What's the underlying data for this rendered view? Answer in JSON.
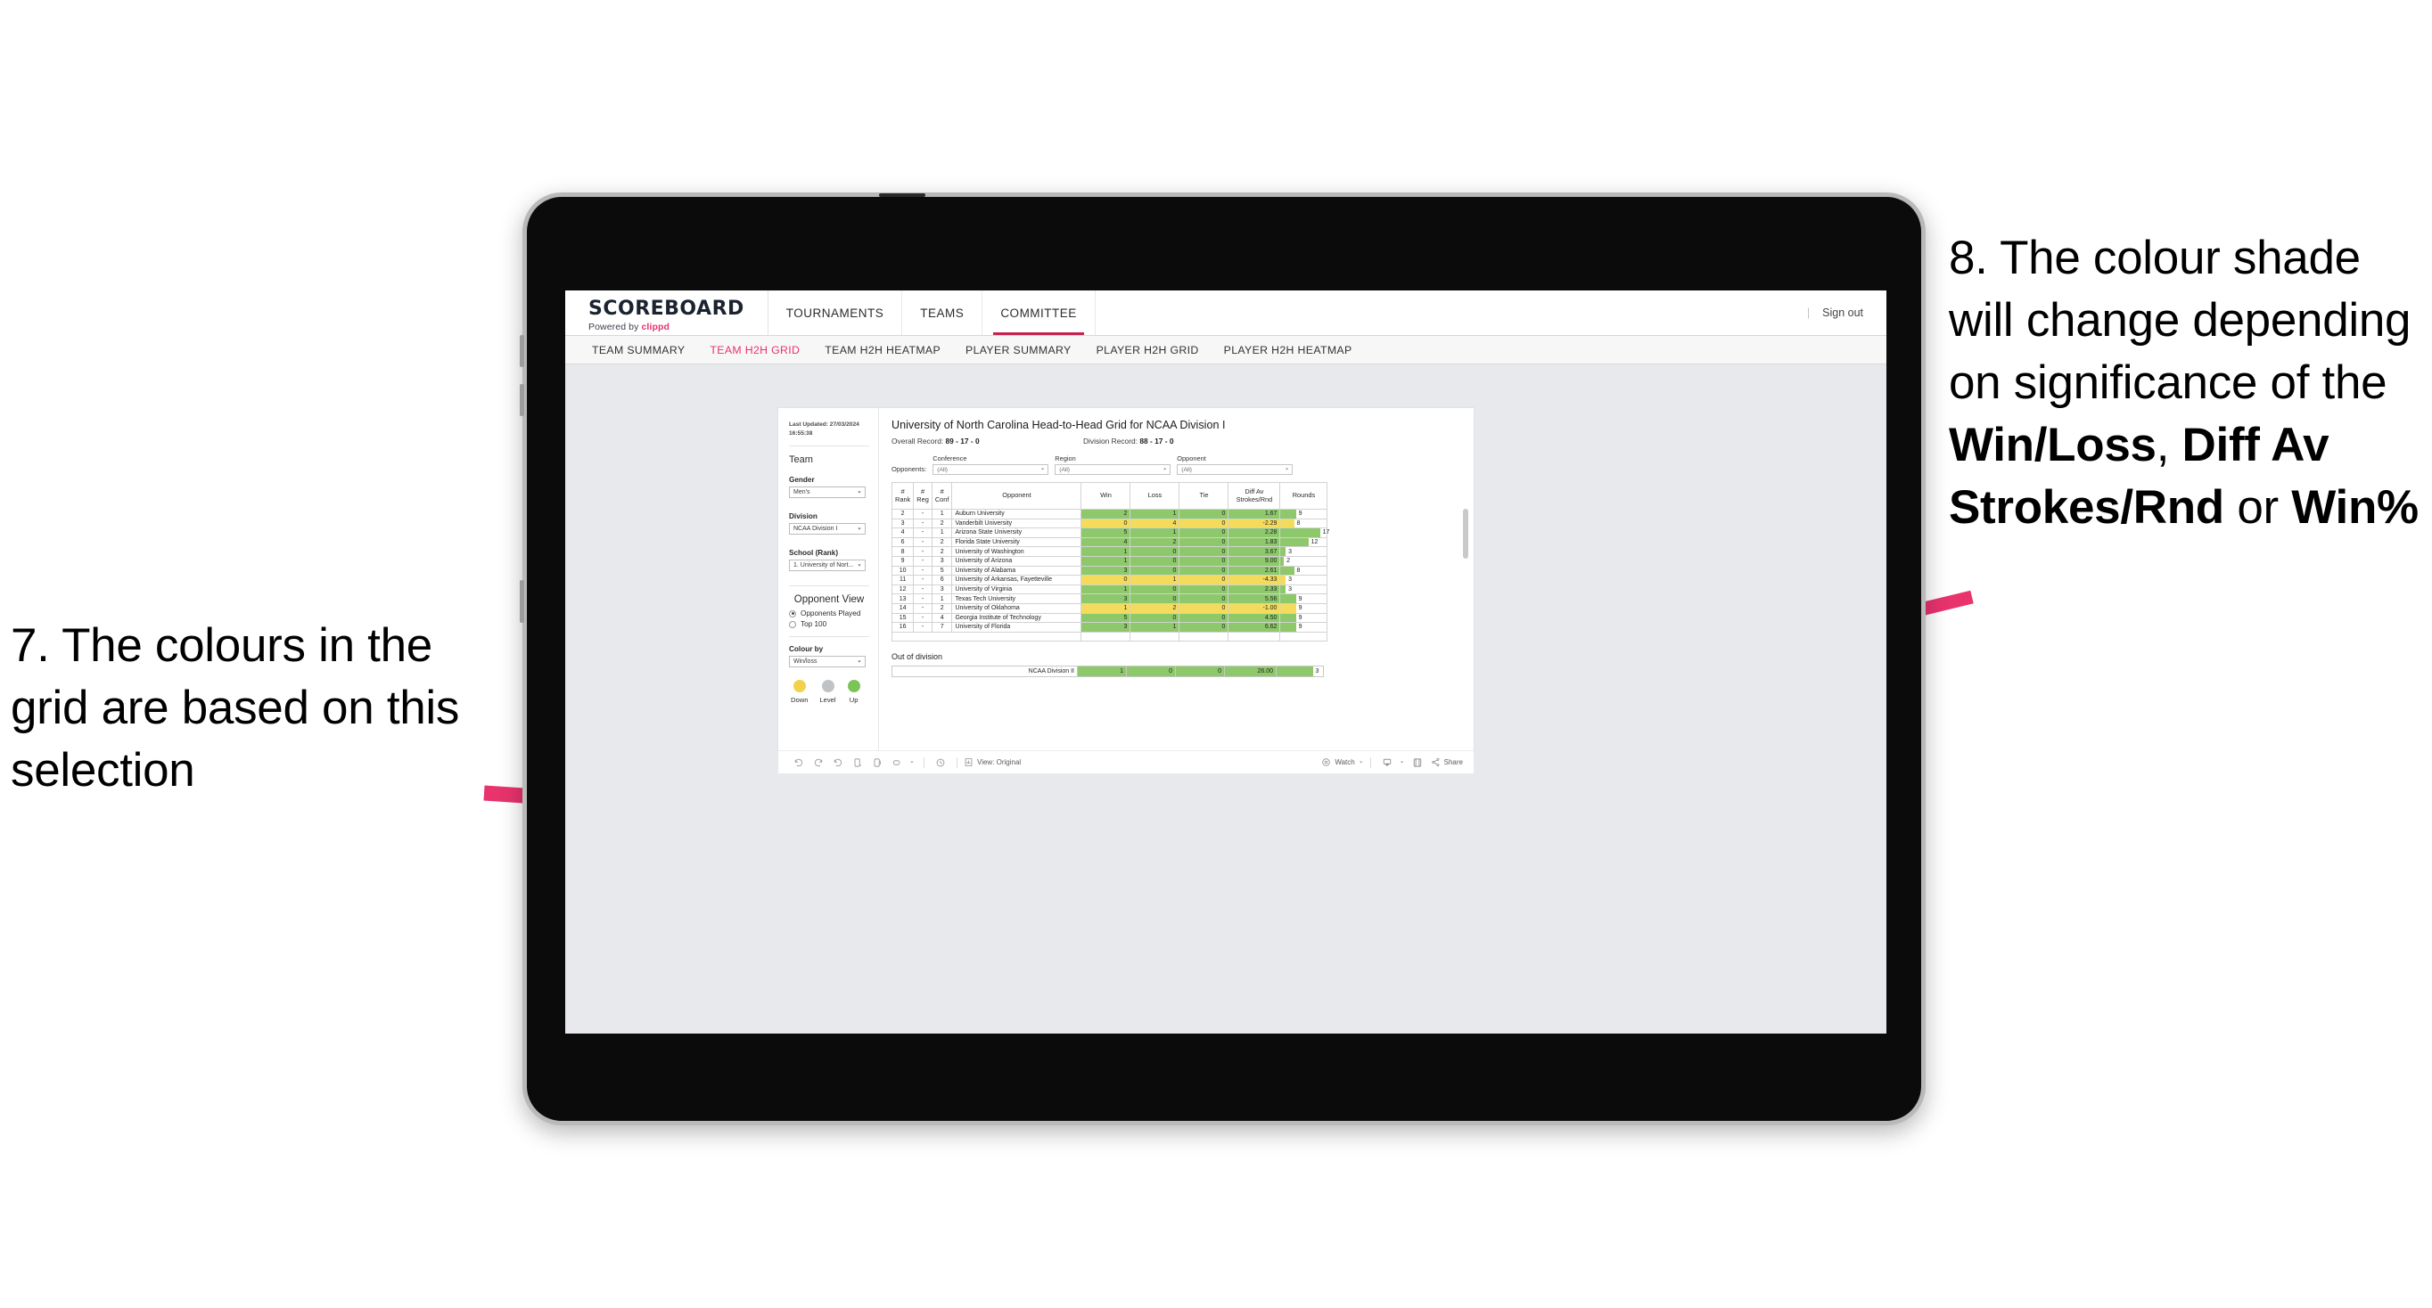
{
  "annotations": {
    "left": "7. The colours in the grid are based on this selection",
    "right_pre": "8. The colour shade will change depending on significance of the ",
    "right_b1": "Win/Loss",
    "right_mid1": ", ",
    "right_b2": "Diff Av Strokes/Rnd",
    "right_mid2": " or ",
    "right_b3": "Win%",
    "arrow_color": "#e8336d"
  },
  "app": {
    "brand": {
      "title": "SCOREBOARD",
      "powered_prefix": "Powered by ",
      "powered_accent": "clippd"
    },
    "topnav": [
      {
        "label": "TOURNAMENTS",
        "active": false
      },
      {
        "label": "TEAMS",
        "active": false
      },
      {
        "label": "COMMITTEE",
        "active": true
      }
    ],
    "header_right": {
      "divider": "|",
      "sign_out": "Sign out"
    },
    "subnav": [
      {
        "label": "TEAM SUMMARY",
        "active": false
      },
      {
        "label": "TEAM H2H GRID",
        "active": true
      },
      {
        "label": "TEAM H2H HEATMAP",
        "active": false
      },
      {
        "label": "PLAYER SUMMARY",
        "active": false
      },
      {
        "label": "PLAYER H2H GRID",
        "active": false
      },
      {
        "label": "PLAYER H2H HEATMAP",
        "active": false
      }
    ]
  },
  "panel": {
    "last_updated": "Last Updated: 27/03/2024 16:55:38",
    "team_heading": "Team",
    "gender_label": "Gender",
    "gender_value": "Men's",
    "division_label": "Division",
    "division_value": "NCAA Division I",
    "school_label": "School (Rank)",
    "school_value": "1. University of Nort...",
    "opponent_view_heading": "Opponent View",
    "opponent_view_options": [
      {
        "label": "Opponents Played",
        "selected": true
      },
      {
        "label": "Top 100",
        "selected": false
      }
    ],
    "colour_by_label": "Colour by",
    "colour_by_value": "Win/loss",
    "legend": [
      {
        "label": "Down",
        "color": "#f2d24b"
      },
      {
        "label": "Level",
        "color": "#c0c3c6"
      },
      {
        "label": "Up",
        "color": "#7cc457"
      }
    ]
  },
  "viz": {
    "title": "University of North Carolina Head-to-Head Grid for NCAA Division I",
    "overall_record_label": "Overall Record: ",
    "overall_record_value": "89 - 17 - 0",
    "division_record_label": "Division Record: ",
    "division_record_value": "88 - 17 - 0",
    "opponents_tag": "Opponents:",
    "filters": [
      {
        "label": "Conference",
        "value": "(All)"
      },
      {
        "label": "Region",
        "value": "(All)"
      },
      {
        "label": "Opponent",
        "value": "(All)"
      }
    ],
    "out_of_division_title": "Out of division",
    "out_of_division_row": {
      "name": "NCAA Division II",
      "win": "1",
      "loss": "0",
      "tie": "0",
      "diff": "26.00",
      "rounds": "3",
      "color": "#8dc96a",
      "bar_pct": 78
    }
  },
  "chart_data": {
    "type": "table",
    "title": "University of North Carolina Head-to-Head Grid for NCAA Division I",
    "columns": [
      "# Rank",
      "# Reg",
      "# Conf",
      "Opponent",
      "Win",
      "Loss",
      "Tie",
      "Diff Av Strokes/Rnd",
      "Rounds"
    ],
    "colour_by": "Win/loss",
    "colors": {
      "up": "#8dc96a",
      "down": "#f4db5c",
      "level": "#c0c3c6"
    },
    "rows": [
      {
        "rank": "2",
        "reg": "-",
        "conf": "1",
        "opponent": "Auburn University",
        "win": "2",
        "loss": "1",
        "tie": "0",
        "diff": "1.67",
        "rounds": "9",
        "color": "#8dc96a",
        "bar_pct": 33
      },
      {
        "rank": "3",
        "reg": "-",
        "conf": "2",
        "opponent": "Vanderbilt University",
        "win": "0",
        "loss": "4",
        "tie": "0",
        "diff": "-2.29",
        "rounds": "8",
        "color": "#f4db5c",
        "bar_pct": 29
      },
      {
        "rank": "4",
        "reg": "-",
        "conf": "1",
        "opponent": "Arizona State University",
        "win": "5",
        "loss": "1",
        "tie": "0",
        "diff": "2.28",
        "rounds": "17",
        "color": "#8dc96a",
        "bar_pct": 85
      },
      {
        "rank": "6",
        "reg": "-",
        "conf": "2",
        "opponent": "Florida State University",
        "win": "4",
        "loss": "2",
        "tie": "0",
        "diff": "1.83",
        "rounds": "12",
        "color": "#8dc96a",
        "bar_pct": 60
      },
      {
        "rank": "8",
        "reg": "-",
        "conf": "2",
        "opponent": "University of Washington",
        "win": "1",
        "loss": "0",
        "tie": "0",
        "diff": "3.67",
        "rounds": "3",
        "color": "#8dc96a",
        "bar_pct": 11
      },
      {
        "rank": "9",
        "reg": "-",
        "conf": "3",
        "opponent": "University of Arizona",
        "win": "1",
        "loss": "0",
        "tie": "0",
        "diff": "9.00",
        "rounds": "2",
        "color": "#8dc96a",
        "bar_pct": 7
      },
      {
        "rank": "10",
        "reg": "-",
        "conf": "5",
        "opponent": "University of Alabama",
        "win": "3",
        "loss": "0",
        "tie": "0",
        "diff": "2.61",
        "rounds": "8",
        "color": "#8dc96a",
        "bar_pct": 29
      },
      {
        "rank": "11",
        "reg": "-",
        "conf": "6",
        "opponent": "University of Arkansas, Fayetteville",
        "win": "0",
        "loss": "1",
        "tie": "0",
        "diff": "-4.33",
        "rounds": "3",
        "color": "#f4db5c",
        "bar_pct": 11
      },
      {
        "rank": "12",
        "reg": "-",
        "conf": "3",
        "opponent": "University of Virginia",
        "win": "1",
        "loss": "0",
        "tie": "0",
        "diff": "2.33",
        "rounds": "3",
        "color": "#8dc96a",
        "bar_pct": 11
      },
      {
        "rank": "13",
        "reg": "-",
        "conf": "1",
        "opponent": "Texas Tech University",
        "win": "3",
        "loss": "0",
        "tie": "0",
        "diff": "5.56",
        "rounds": "9",
        "color": "#8dc96a",
        "bar_pct": 33
      },
      {
        "rank": "14",
        "reg": "-",
        "conf": "2",
        "opponent": "University of Oklahoma",
        "win": "1",
        "loss": "2",
        "tie": "0",
        "diff": "-1.00",
        "rounds": "9",
        "color": "#f4db5c",
        "bar_pct": 33
      },
      {
        "rank": "15",
        "reg": "-",
        "conf": "4",
        "opponent": "Georgia Institute of Technology",
        "win": "5",
        "loss": "0",
        "tie": "0",
        "diff": "4.50",
        "rounds": "9",
        "color": "#8dc96a",
        "bar_pct": 33
      },
      {
        "rank": "16",
        "reg": "-",
        "conf": "7",
        "opponent": "University of Florida",
        "win": "3",
        "loss": "1",
        "tie": "0",
        "diff": "6.62",
        "rounds": "9",
        "color": "#8dc96a",
        "bar_pct": 33
      }
    ]
  },
  "toolbar": {
    "view_label": "View: Original",
    "watch_label": "Watch",
    "share_label": "Share"
  }
}
